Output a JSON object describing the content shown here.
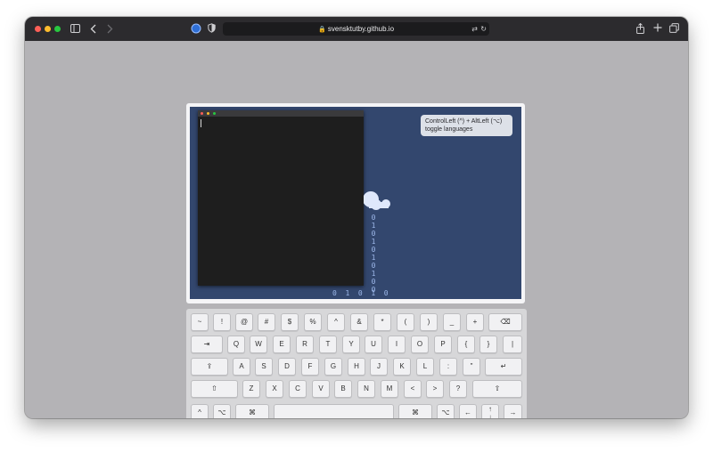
{
  "browser": {
    "url": "svensktutby.github.io",
    "traffic_lights": [
      "#ff5f57",
      "#febc2e",
      "#28c840"
    ]
  },
  "tooltip": {
    "line1": "ControlLeft (^) + AltLeft (⌥)",
    "line2": "toggle languages"
  },
  "binary_stream": {
    "column": [
      "0",
      "1",
      "0",
      "1",
      "0",
      "1",
      "0",
      "1",
      "0",
      "0"
    ],
    "bottom_row": "0  1  0  1  0"
  },
  "keyboard": {
    "rows": [
      [
        {
          "label": "~",
          "name": "key-tilde"
        },
        {
          "label": "!",
          "name": "key-exclamation"
        },
        {
          "label": "@",
          "name": "key-at"
        },
        {
          "label": "#",
          "name": "key-hash"
        },
        {
          "label": "$",
          "name": "key-dollar"
        },
        {
          "label": "%",
          "name": "key-percent"
        },
        {
          "label": "^",
          "name": "key-caret"
        },
        {
          "label": "&",
          "name": "key-ampersand"
        },
        {
          "label": "*",
          "name": "key-asterisk"
        },
        {
          "label": "(",
          "name": "key-open-paren"
        },
        {
          "label": ")",
          "name": "key-close-paren"
        },
        {
          "label": "_",
          "name": "key-underscore"
        },
        {
          "label": "+",
          "name": "key-plus"
        },
        {
          "label": "⌫",
          "name": "key-backspace"
        }
      ],
      [
        {
          "label": "⇥",
          "name": "key-tab"
        },
        {
          "label": "Q",
          "name": "key-q"
        },
        {
          "label": "W",
          "name": "key-w"
        },
        {
          "label": "E",
          "name": "key-e"
        },
        {
          "label": "R",
          "name": "key-r"
        },
        {
          "label": "T",
          "name": "key-t"
        },
        {
          "label": "Y",
          "name": "key-y"
        },
        {
          "label": "U",
          "name": "key-u"
        },
        {
          "label": "I",
          "name": "key-i"
        },
        {
          "label": "O",
          "name": "key-o"
        },
        {
          "label": "P",
          "name": "key-p"
        },
        {
          "label": "{",
          "name": "key-open-brace"
        },
        {
          "label": "}",
          "name": "key-close-brace"
        },
        {
          "label": "|",
          "name": "key-pipe"
        }
      ],
      [
        {
          "label": "⇪",
          "name": "key-caps-lock"
        },
        {
          "label": "A",
          "name": "key-a"
        },
        {
          "label": "S",
          "name": "key-s"
        },
        {
          "label": "D",
          "name": "key-d"
        },
        {
          "label": "F",
          "name": "key-f"
        },
        {
          "label": "G",
          "name": "key-g"
        },
        {
          "label": "H",
          "name": "key-h"
        },
        {
          "label": "J",
          "name": "key-j"
        },
        {
          "label": "K",
          "name": "key-k"
        },
        {
          "label": "L",
          "name": "key-l"
        },
        {
          "label": ":",
          "name": "key-colon"
        },
        {
          "label": "\"",
          "name": "key-quote"
        },
        {
          "label": "↵",
          "name": "key-return"
        }
      ],
      [
        {
          "label": "⇧",
          "name": "key-shift-left"
        },
        {
          "label": "Z",
          "name": "key-z"
        },
        {
          "label": "X",
          "name": "key-x"
        },
        {
          "label": "C",
          "name": "key-c"
        },
        {
          "label": "V",
          "name": "key-v"
        },
        {
          "label": "B",
          "name": "key-b"
        },
        {
          "label": "N",
          "name": "key-n"
        },
        {
          "label": "M",
          "name": "key-m"
        },
        {
          "label": "<",
          "name": "key-less-than"
        },
        {
          "label": ">",
          "name": "key-greater-than"
        },
        {
          "label": "?",
          "name": "key-question"
        },
        {
          "label": "⇧",
          "name": "key-shift-right"
        }
      ],
      [
        {
          "label": "^",
          "name": "key-control"
        },
        {
          "label": "⌥",
          "name": "key-option-left"
        },
        {
          "label": "⌘",
          "name": "key-command-left"
        },
        {
          "label": "",
          "name": "key-space"
        },
        {
          "label": "⌘",
          "name": "key-command-right"
        },
        {
          "label": "⌥",
          "name": "key-option-right"
        },
        {
          "label": "←",
          "name": "key-arrow-left"
        },
        {
          "label": "↑",
          "name": "key-arrow-up"
        },
        {
          "label": "↓",
          "name": "key-arrow-down"
        },
        {
          "label": "→",
          "name": "key-arrow-right"
        }
      ]
    ]
  }
}
